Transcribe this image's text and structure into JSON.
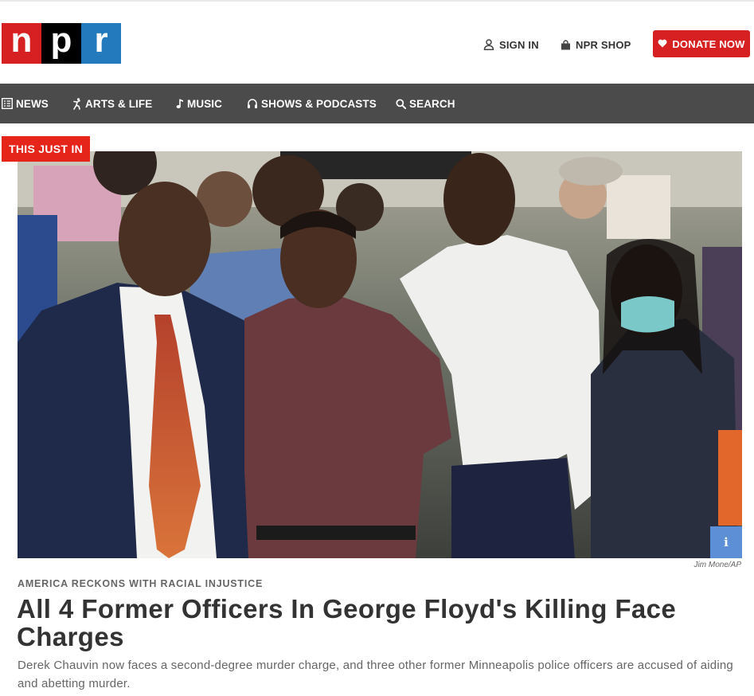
{
  "header": {
    "logo": {
      "letters": [
        "n",
        "p",
        "r"
      ],
      "colors": [
        "#d62021",
        "#000000",
        "#237bbd"
      ]
    },
    "sign_in": {
      "label": "SIGN IN",
      "icon": "user-icon"
    },
    "shop": {
      "label": "NPR SHOP",
      "icon": "shopping-bag-icon"
    },
    "donate": {
      "label": "DONATE NOW",
      "icon": "heart-icon",
      "color": "#d62021"
    }
  },
  "nav": {
    "items": [
      {
        "label": "NEWS",
        "icon": "news-list-icon"
      },
      {
        "label": "ARTS & LIFE",
        "icon": "dancer-icon"
      },
      {
        "label": "MUSIC",
        "icon": "music-note-icon"
      },
      {
        "label": "SHOWS & PODCASTS",
        "icon": "headphones-icon"
      },
      {
        "label": "SEARCH",
        "icon": "search-icon"
      }
    ]
  },
  "story": {
    "badge": "THIS JUST IN",
    "info_button": "i",
    "photo_credit": "Jim Mone/AP",
    "slug": "AMERICA RECKONS WITH RACIAL INJUSTICE",
    "headline": "All 4 Former Officers In George Floyd's Killing Face Charges",
    "teaser": "Derek Chauvin now faces a second-degree murder charge, and three other former Minneapolis police officers are accused of aiding and abetting murder."
  },
  "colors": {
    "badge": "#e5251a",
    "nav_bg": "#4b4b4b",
    "info_button": "#5d8fd6"
  }
}
